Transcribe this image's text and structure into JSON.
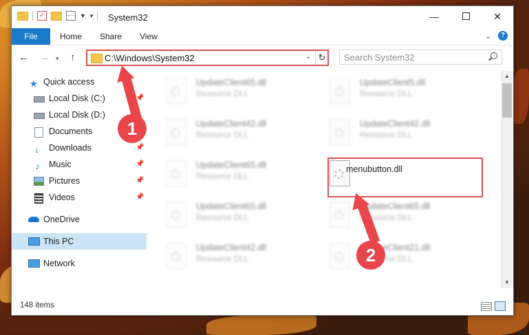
{
  "window": {
    "title": "System32"
  },
  "ribbon": {
    "tabs": [
      "File",
      "Home",
      "Share",
      "View"
    ]
  },
  "navigation": {
    "address": "C:\\Windows\\System32",
    "search_placeholder": "Search System32"
  },
  "sidebar": {
    "items": [
      {
        "label": "Quick access",
        "icon": "star-icon",
        "pinned": false,
        "selected": false
      },
      {
        "label": "Local Disk (C:)",
        "icon": "drive-icon",
        "pinned": true,
        "selected": false
      },
      {
        "label": "Local Disk (D:)",
        "icon": "drive-icon",
        "pinned": true,
        "selected": false
      },
      {
        "label": "Documents",
        "icon": "documents-icon",
        "pinned": true,
        "selected": false
      },
      {
        "label": "Downloads",
        "icon": "download-arrow-icon",
        "pinned": true,
        "selected": false
      },
      {
        "label": "Music",
        "icon": "music-note-icon",
        "pinned": true,
        "selected": false
      },
      {
        "label": "Pictures",
        "icon": "pictures-icon",
        "pinned": true,
        "selected": false
      },
      {
        "label": "Videos",
        "icon": "film-icon",
        "pinned": true,
        "selected": false
      },
      {
        "label": "OneDrive",
        "icon": "cloud-icon",
        "pinned": false,
        "selected": false
      },
      {
        "label": "This PC",
        "icon": "monitor-icon",
        "pinned": false,
        "selected": true
      },
      {
        "label": "Network",
        "icon": "network-icon",
        "pinned": false,
        "selected": false
      }
    ]
  },
  "files": {
    "left_column": [
      {
        "name": "UpdateClient65.dll",
        "type": "Resource DLL"
      },
      {
        "name": "UpdateClient42.dll",
        "type": "Resource DLL"
      },
      {
        "name": "UpdateClient65.dll",
        "type": "Resource DLL"
      },
      {
        "name": "UpdateClient65.dll",
        "type": "Resource DLL"
      },
      {
        "name": "UpdateClient42.dll",
        "type": "Resource DLL"
      }
    ],
    "right_column": [
      {
        "name": "UpdateClient5.dll",
        "type": "Resource DLL"
      },
      {
        "name": "UpdateClient42.dll",
        "type": "Resource DLL"
      },
      {
        "name": "menubutton.dll",
        "type": ""
      },
      {
        "name": "UpdateClient65.dll",
        "type": "Resource DLL"
      },
      {
        "name": "UpdateClient21.dll",
        "type": "Resource DLL"
      }
    ]
  },
  "status": {
    "item_count": "148 items"
  },
  "annotations": {
    "step1": "1",
    "step2": "2"
  },
  "colors": {
    "accent": "#1979ca",
    "highlight": "#d9534f",
    "badge": "#e8464b",
    "selected_bg": "#cce4f7"
  }
}
